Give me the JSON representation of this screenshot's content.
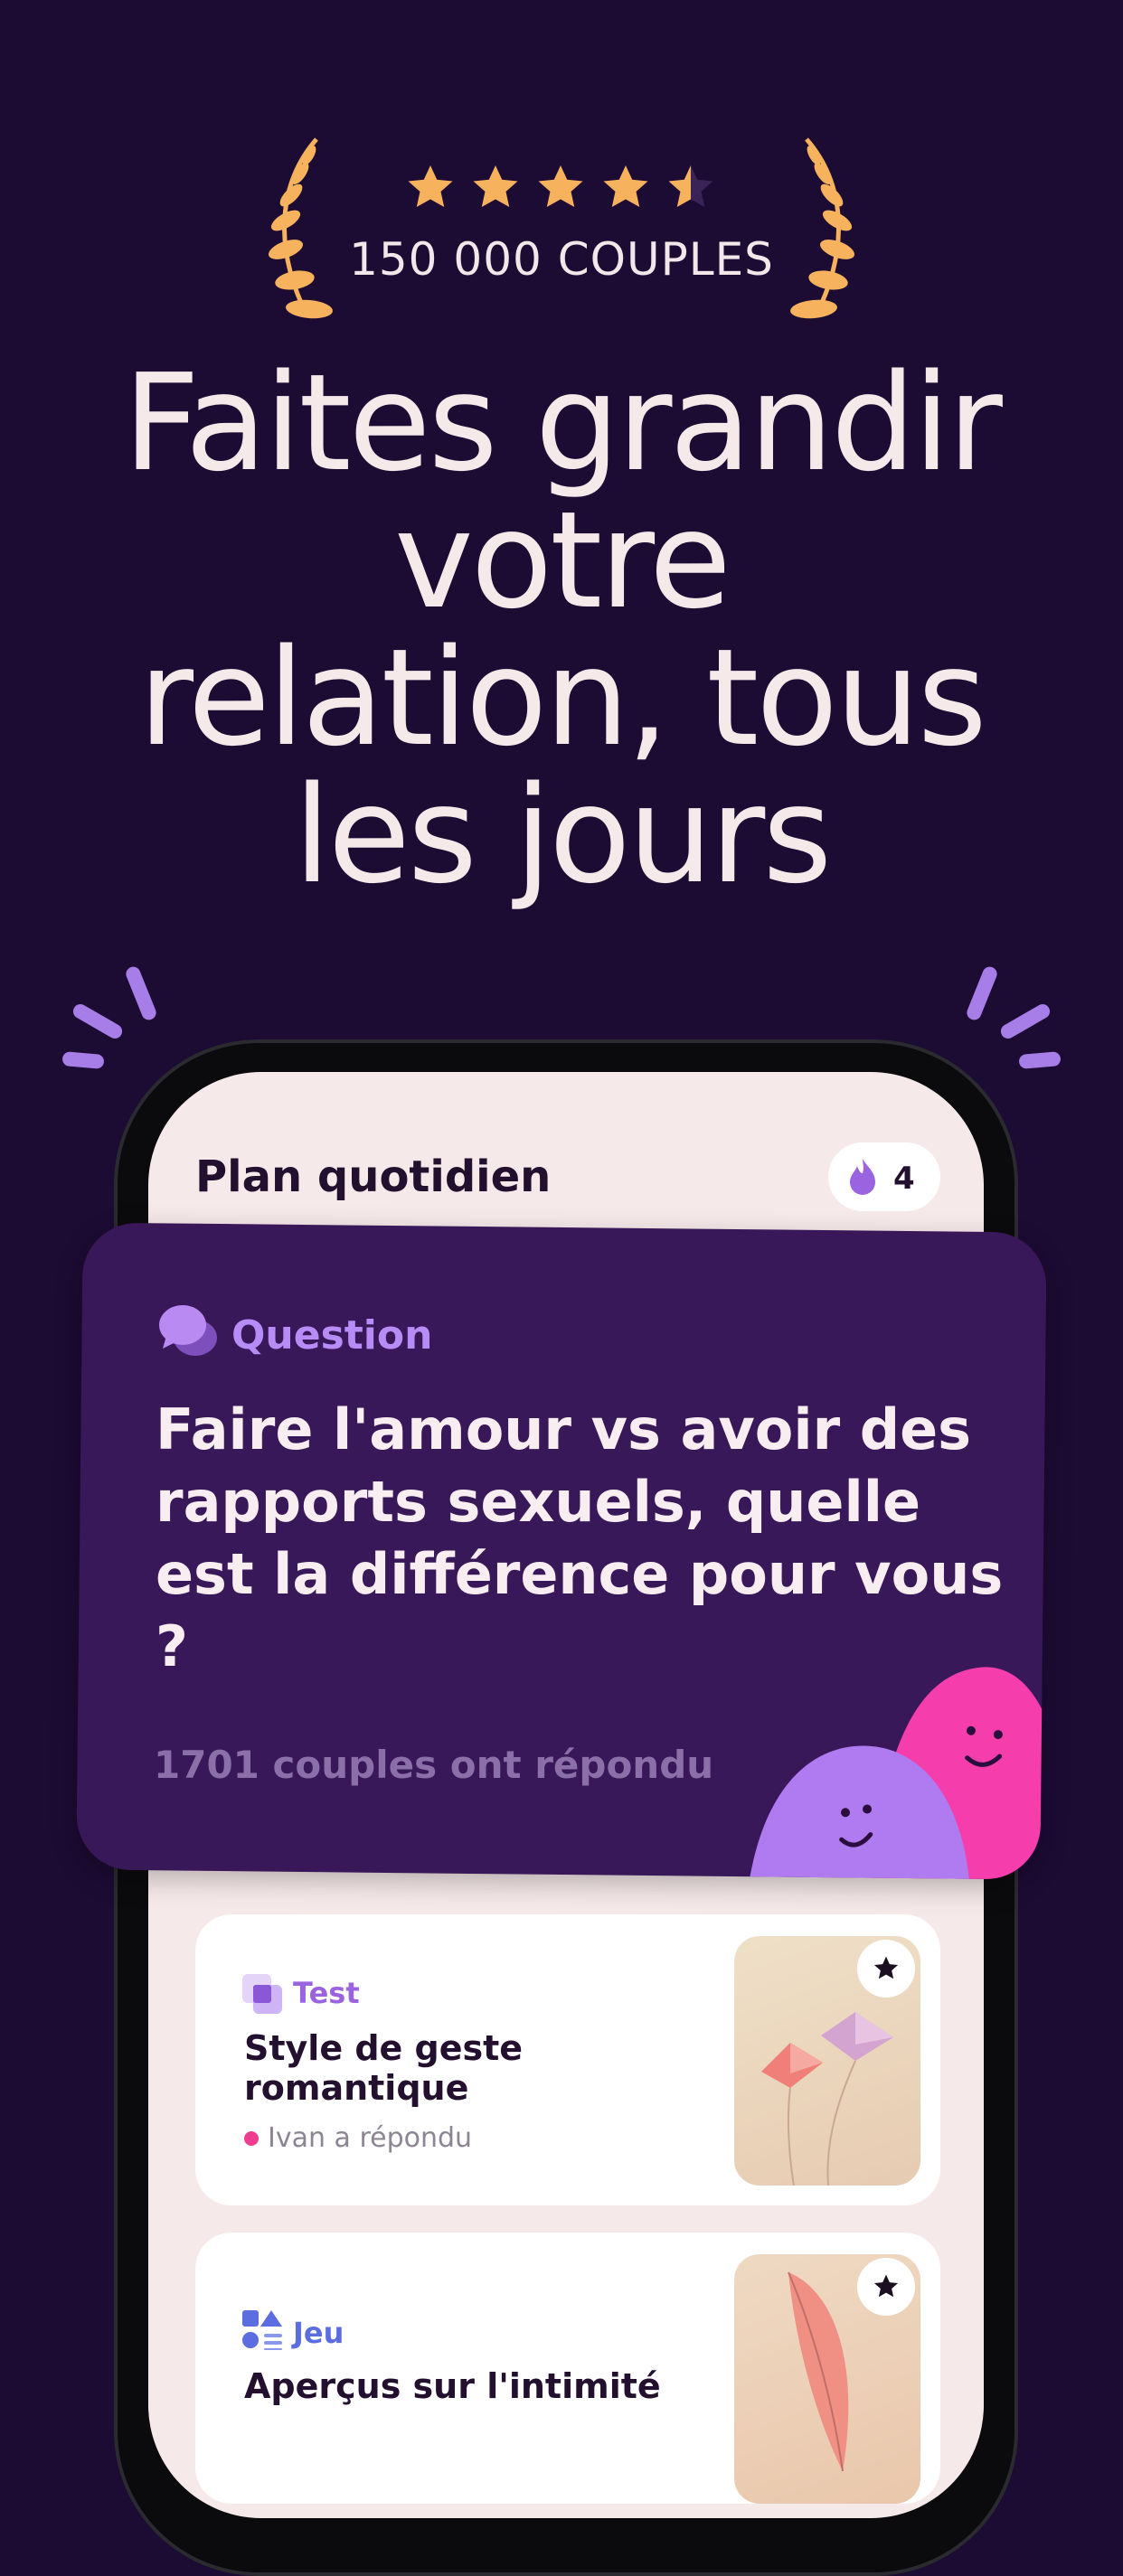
{
  "rating": {
    "stars": 4.5,
    "max_stars": 5,
    "couples_label": "150 000 COUPLES"
  },
  "headline": {
    "lines": [
      "Faites grandir",
      "votre",
      "relation, tous",
      "les jours"
    ]
  },
  "phone": {
    "header": {
      "title": "Plan quotidien",
      "streak_icon": "flame-icon",
      "streak_count": "4"
    },
    "question_card": {
      "category_icon": "chat-bubbles-icon",
      "category": "Question",
      "text": "Faire l'amour vs avoir des rapports sexuels, quelle est la différence pour vous ?",
      "answered": "1701 couples ont répondu",
      "colors": {
        "background": "#381858",
        "accent": "#b78cf6",
        "mascot_purple": "#b07af0",
        "mascot_pink": "#f53eab"
      }
    },
    "items": [
      {
        "category_icon": "test-icon",
        "category": "Test",
        "title": "Style de geste romantique",
        "status": "Ivan a répondu",
        "image": "paper-kites-image",
        "favorite_icon": "star-icon"
      },
      {
        "category_icon": "game-shapes-icon",
        "category": "Jeu",
        "title": "Aperçus sur l'intimité",
        "image": "feather-image",
        "favorite_icon": "star-icon"
      }
    ]
  },
  "colors": {
    "background": "#1c0b33",
    "star": "#f6b25c",
    "headline_text": "#f6e9ea",
    "status_dot": "#ef3e8e"
  }
}
